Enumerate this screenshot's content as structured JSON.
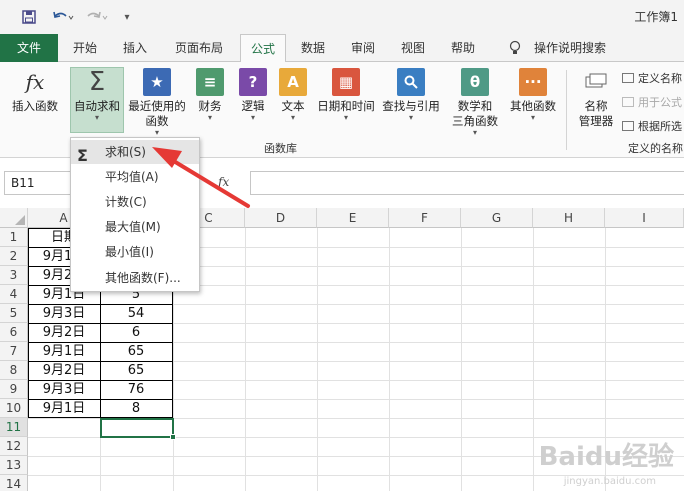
{
  "titlebar": {
    "title": "工作簿1",
    "more": "▾"
  },
  "tabs": [
    "文件",
    "开始",
    "插入",
    "页面布局",
    "公式",
    "数据",
    "审阅",
    "视图",
    "帮助",
    "操作说明搜索"
  ],
  "ribbon": {
    "insert_function": "插入函数",
    "autosum_line1": "自动求和",
    "recent_line1": "最近使用的",
    "recent_line2": "函数",
    "finance": "财务",
    "logic": "逻辑",
    "text": "文本",
    "datetime": "日期和时间",
    "lookup": "查找与引用",
    "math_line1": "数学和",
    "math_line2": "三角函数",
    "other": "其他函数",
    "name_mgr_line1": "名称",
    "name_mgr_line2": "管理器",
    "define_name": "定义名称",
    "use_in_formula": "用于公式",
    "create_from_sel": "根据所选",
    "group_library": "函数库",
    "group_names": "定义的名称"
  },
  "formula_bar": {
    "name_box": "B11",
    "fx": "fx",
    "value": ""
  },
  "columns": [
    "A",
    "B",
    "C",
    "D",
    "E",
    "F",
    "G",
    "H",
    "I"
  ],
  "rows": [
    "1",
    "2",
    "3",
    "4",
    "5",
    "6",
    "7",
    "8",
    "9",
    "10",
    "11",
    "12",
    "13",
    "14"
  ],
  "table": {
    "header_a": "日期",
    "rows": [
      {
        "a": "9月1日",
        "b": ""
      },
      {
        "a": "9月2日",
        "b": ""
      },
      {
        "a": "9月1日",
        "b": "5"
      },
      {
        "a": "9月3日",
        "b": "54"
      },
      {
        "a": "9月2日",
        "b": "6"
      },
      {
        "a": "9月1日",
        "b": "65"
      },
      {
        "a": "9月2日",
        "b": "65"
      },
      {
        "a": "9月3日",
        "b": "76"
      },
      {
        "a": "9月1日",
        "b": "8"
      }
    ]
  },
  "menu": {
    "items": [
      "求和(S)",
      "平均值(A)",
      "计数(C)",
      "最大值(M)",
      "最小值(I)",
      "其他函数(F)..."
    ]
  },
  "watermark": {
    "main": "Baidu经验",
    "sub": "jingyan.baidu.com"
  },
  "colors": {
    "excel_green": "#217346",
    "arrow_red": "#e53935"
  }
}
